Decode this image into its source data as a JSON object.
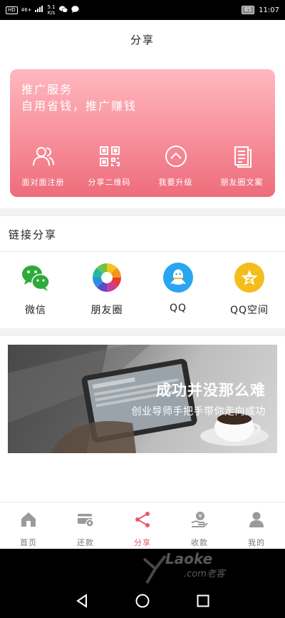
{
  "status_bar": {
    "hd": "HD",
    "signal": "46+",
    "speed_value": "5.1",
    "speed_unit": "K/s",
    "battery": "85",
    "time": "11:07"
  },
  "header": {
    "title": "分享"
  },
  "promo": {
    "title": "推广服务",
    "subtitle": "自用省钱，推广赚钱",
    "actions": [
      {
        "label": "面对面注册",
        "icon": "user-group-icon"
      },
      {
        "label": "分享二维码",
        "icon": "qrcode-icon"
      },
      {
        "label": "我要升级",
        "icon": "upgrade-arrow-icon"
      },
      {
        "label": "朋友圈文案",
        "icon": "document-icon"
      }
    ]
  },
  "link_share": {
    "title": "链接分享",
    "items": [
      {
        "label": "微信",
        "icon": "wechat-icon",
        "color": "#2eaa3a"
      },
      {
        "label": "朋友圈",
        "icon": "moments-icon",
        "color": "#f0a020"
      },
      {
        "label": "QQ",
        "icon": "qq-icon",
        "color": "#2aa5f0"
      },
      {
        "label": "QQ空间",
        "icon": "qzone-icon",
        "color": "#f5bd1a"
      }
    ]
  },
  "banner": {
    "headline": "成功并没那么难",
    "subline": "创业导师手把手带你走向成功"
  },
  "bottom_nav": {
    "active_color": "#e8596b",
    "items": [
      {
        "label": "首页",
        "icon": "home-icon"
      },
      {
        "label": "还款",
        "icon": "card-icon"
      },
      {
        "label": "分享",
        "icon": "share-icon",
        "active": true
      },
      {
        "label": "收款",
        "icon": "receive-money-icon"
      },
      {
        "label": "我的",
        "icon": "person-icon"
      }
    ]
  },
  "watermark": {
    "brand": "Laoke",
    "sub": ".com老客"
  }
}
